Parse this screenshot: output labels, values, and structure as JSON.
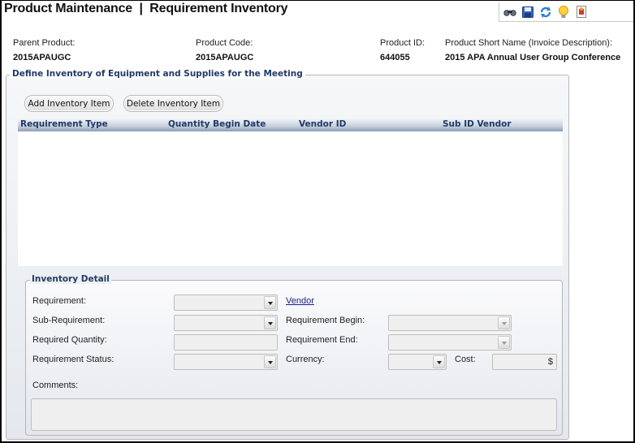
{
  "header": {
    "title": "Product Maintenance  |  Requirement Inventory",
    "toolbar_icons": [
      "binoculars-icon",
      "save-icon",
      "refresh-icon",
      "lightbulb-icon",
      "report-icon"
    ]
  },
  "product_info": {
    "parent_product": {
      "label": "Parent Product:",
      "value": "2015APAUGC"
    },
    "product_code": {
      "label": "Product Code:",
      "value": "2015APAUGC"
    },
    "product_id": {
      "label": "Product ID:",
      "value": "644055"
    },
    "short_name": {
      "label": "Product Short Name (Invoice Description):",
      "value": "2015 APA Annual User Group Conference"
    }
  },
  "inventory": {
    "legend": "Define Inventory of Equipment and Supplies for the Meeting",
    "add_button": "Add Inventory Item",
    "delete_button": "Delete Inventory Item",
    "columns": [
      "Requirement Type",
      "Quantity Begin Date",
      "Vendor ID",
      "Sub ID Vendor"
    ],
    "rows": []
  },
  "detail": {
    "legend": "Inventory Detail",
    "requirement": {
      "label": "Requirement:",
      "value": ""
    },
    "sub_requirement": {
      "label": "Sub-Requirement:",
      "value": ""
    },
    "required_quantity": {
      "label": "Required Quantity:",
      "value": ""
    },
    "requirement_status": {
      "label": "Requirement Status:",
      "value": ""
    },
    "vendor_link": "Vendor",
    "requirement_begin": {
      "label": "Requirement Begin:",
      "value": ""
    },
    "requirement_end": {
      "label": "Requirement End:",
      "value": ""
    },
    "currency": {
      "label": "Currency:",
      "value": ""
    },
    "cost": {
      "label": "Cost:",
      "value": "",
      "symbol": "$"
    },
    "comments": {
      "label": "Comments:",
      "value": ""
    }
  }
}
